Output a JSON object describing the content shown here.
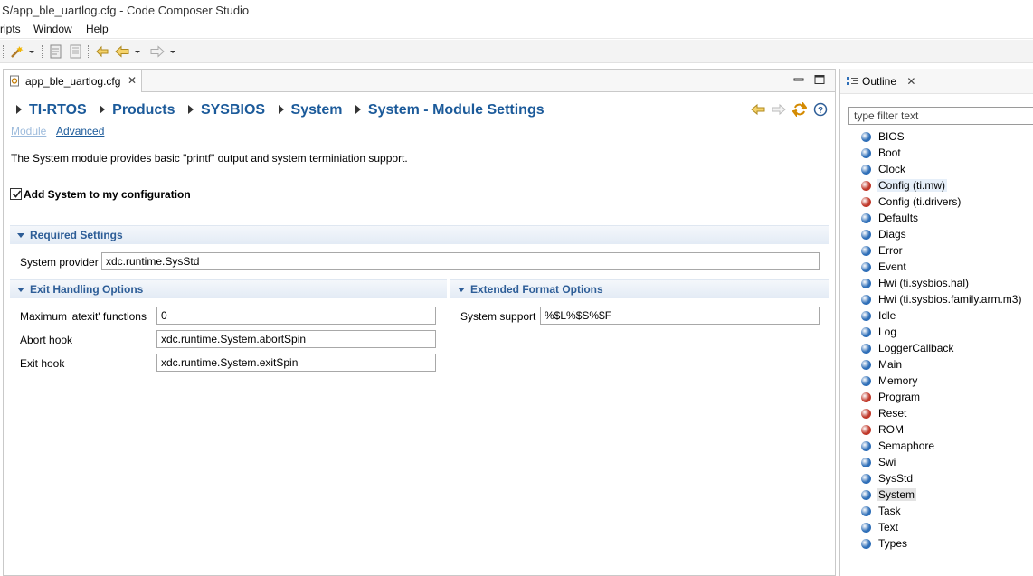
{
  "window": {
    "title": "S/app_ble_uartlog.cfg - Code Composer Studio"
  },
  "menu": {
    "items": [
      "ripts",
      "Window",
      "Help"
    ]
  },
  "editor": {
    "tab_label": "app_ble_uartlog.cfg",
    "breadcrumb": [
      "TI-RTOS",
      "Products",
      "SYSBIOS",
      "System",
      "System - Module Settings"
    ],
    "links": {
      "module": "Module",
      "advanced": "Advanced"
    },
    "description": "The System module provides basic \"printf\" output and system terminiation support.",
    "add_checkbox_label": "Add System to my configuration",
    "required": {
      "title": "Required Settings",
      "provider_label": "System provider",
      "provider_value": "xdc.runtime.SysStd"
    },
    "exit": {
      "title": "Exit Handling Options",
      "atexit_label": "Maximum 'atexit' functions",
      "atexit_value": "0",
      "abort_label": "Abort hook",
      "abort_value": "xdc.runtime.System.abortSpin",
      "exit_label": "Exit hook",
      "exit_value": "xdc.runtime.System.exitSpin"
    },
    "extended": {
      "title": "Extended Format Options",
      "support_label": "System support",
      "support_value": "%$L%$S%$F"
    }
  },
  "outline": {
    "tab_label": "Outline",
    "filter_placeholder": "type filter text",
    "colors": {
      "blue": "#2f6fb8",
      "red": "#c0392b"
    },
    "items": [
      {
        "label": "BIOS",
        "color": "blue"
      },
      {
        "label": "Boot",
        "color": "blue"
      },
      {
        "label": "Clock",
        "color": "blue"
      },
      {
        "label": "Config (ti.mw)",
        "color": "red"
      },
      {
        "label": "Config (ti.drivers)",
        "color": "red"
      },
      {
        "label": "Defaults",
        "color": "blue"
      },
      {
        "label": "Diags",
        "color": "blue"
      },
      {
        "label": "Error",
        "color": "blue"
      },
      {
        "label": "Event",
        "color": "blue"
      },
      {
        "label": "Hwi (ti.sysbios.hal)",
        "color": "blue"
      },
      {
        "label": "Hwi (ti.sysbios.family.arm.m3)",
        "color": "blue"
      },
      {
        "label": "Idle",
        "color": "blue"
      },
      {
        "label": "Log",
        "color": "blue"
      },
      {
        "label": "LoggerCallback",
        "color": "blue"
      },
      {
        "label": "Main",
        "color": "blue"
      },
      {
        "label": "Memory",
        "color": "blue"
      },
      {
        "label": "Program",
        "color": "red"
      },
      {
        "label": "Reset",
        "color": "red"
      },
      {
        "label": "ROM",
        "color": "red"
      },
      {
        "label": "Semaphore",
        "color": "blue"
      },
      {
        "label": "Swi",
        "color": "blue"
      },
      {
        "label": "SysStd",
        "color": "blue"
      },
      {
        "label": "System",
        "color": "blue"
      },
      {
        "label": "Task",
        "color": "blue"
      },
      {
        "label": "Text",
        "color": "blue"
      },
      {
        "label": "Types",
        "color": "blue"
      }
    ],
    "selected": "System",
    "hovered": "Config (ti.mw)"
  }
}
